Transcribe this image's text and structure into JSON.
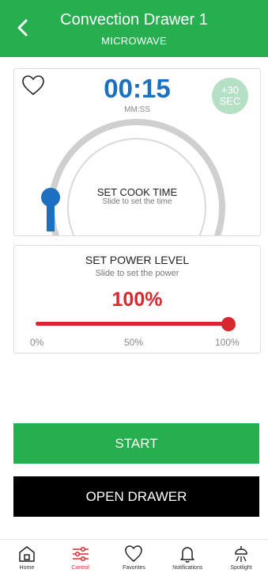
{
  "header": {
    "title": "Convection Drawer  1",
    "subtitle": "MICROWAVE",
    "background_color": "#27ae4f",
    "back_icon": "chevron-left-icon"
  },
  "timer": {
    "favorite_icon": "heart-icon",
    "time": "00:15",
    "format_label": "MM:SS",
    "plus_button": {
      "line1": "+30",
      "line2": "SEC"
    },
    "set_label": "SET COOK TIME",
    "set_hint": "Slide to set the time",
    "time_color": "#1d6fbf"
  },
  "power": {
    "title": "SET POWER LEVEL",
    "hint": "Slide to set the power",
    "value_label": "100%",
    "level_fraction": 1.0,
    "ticks": [
      "0%",
      "50%",
      "100%"
    ],
    "accent_color": "#d7282f"
  },
  "actions": {
    "start_label": "START",
    "open_label": "OPEN DRAWER",
    "start_color": "#27ae4f"
  },
  "nav": {
    "items": [
      {
        "label": "Home",
        "icon": "home-icon",
        "active": false
      },
      {
        "label": "Control",
        "icon": "sliders-icon",
        "active": true
      },
      {
        "label": "Favorites",
        "icon": "heart-icon",
        "active": false
      },
      {
        "label": "Notifications",
        "icon": "bell-icon",
        "active": false
      },
      {
        "label": "Spotlight",
        "icon": "spotlight-icon",
        "active": false
      }
    ]
  }
}
